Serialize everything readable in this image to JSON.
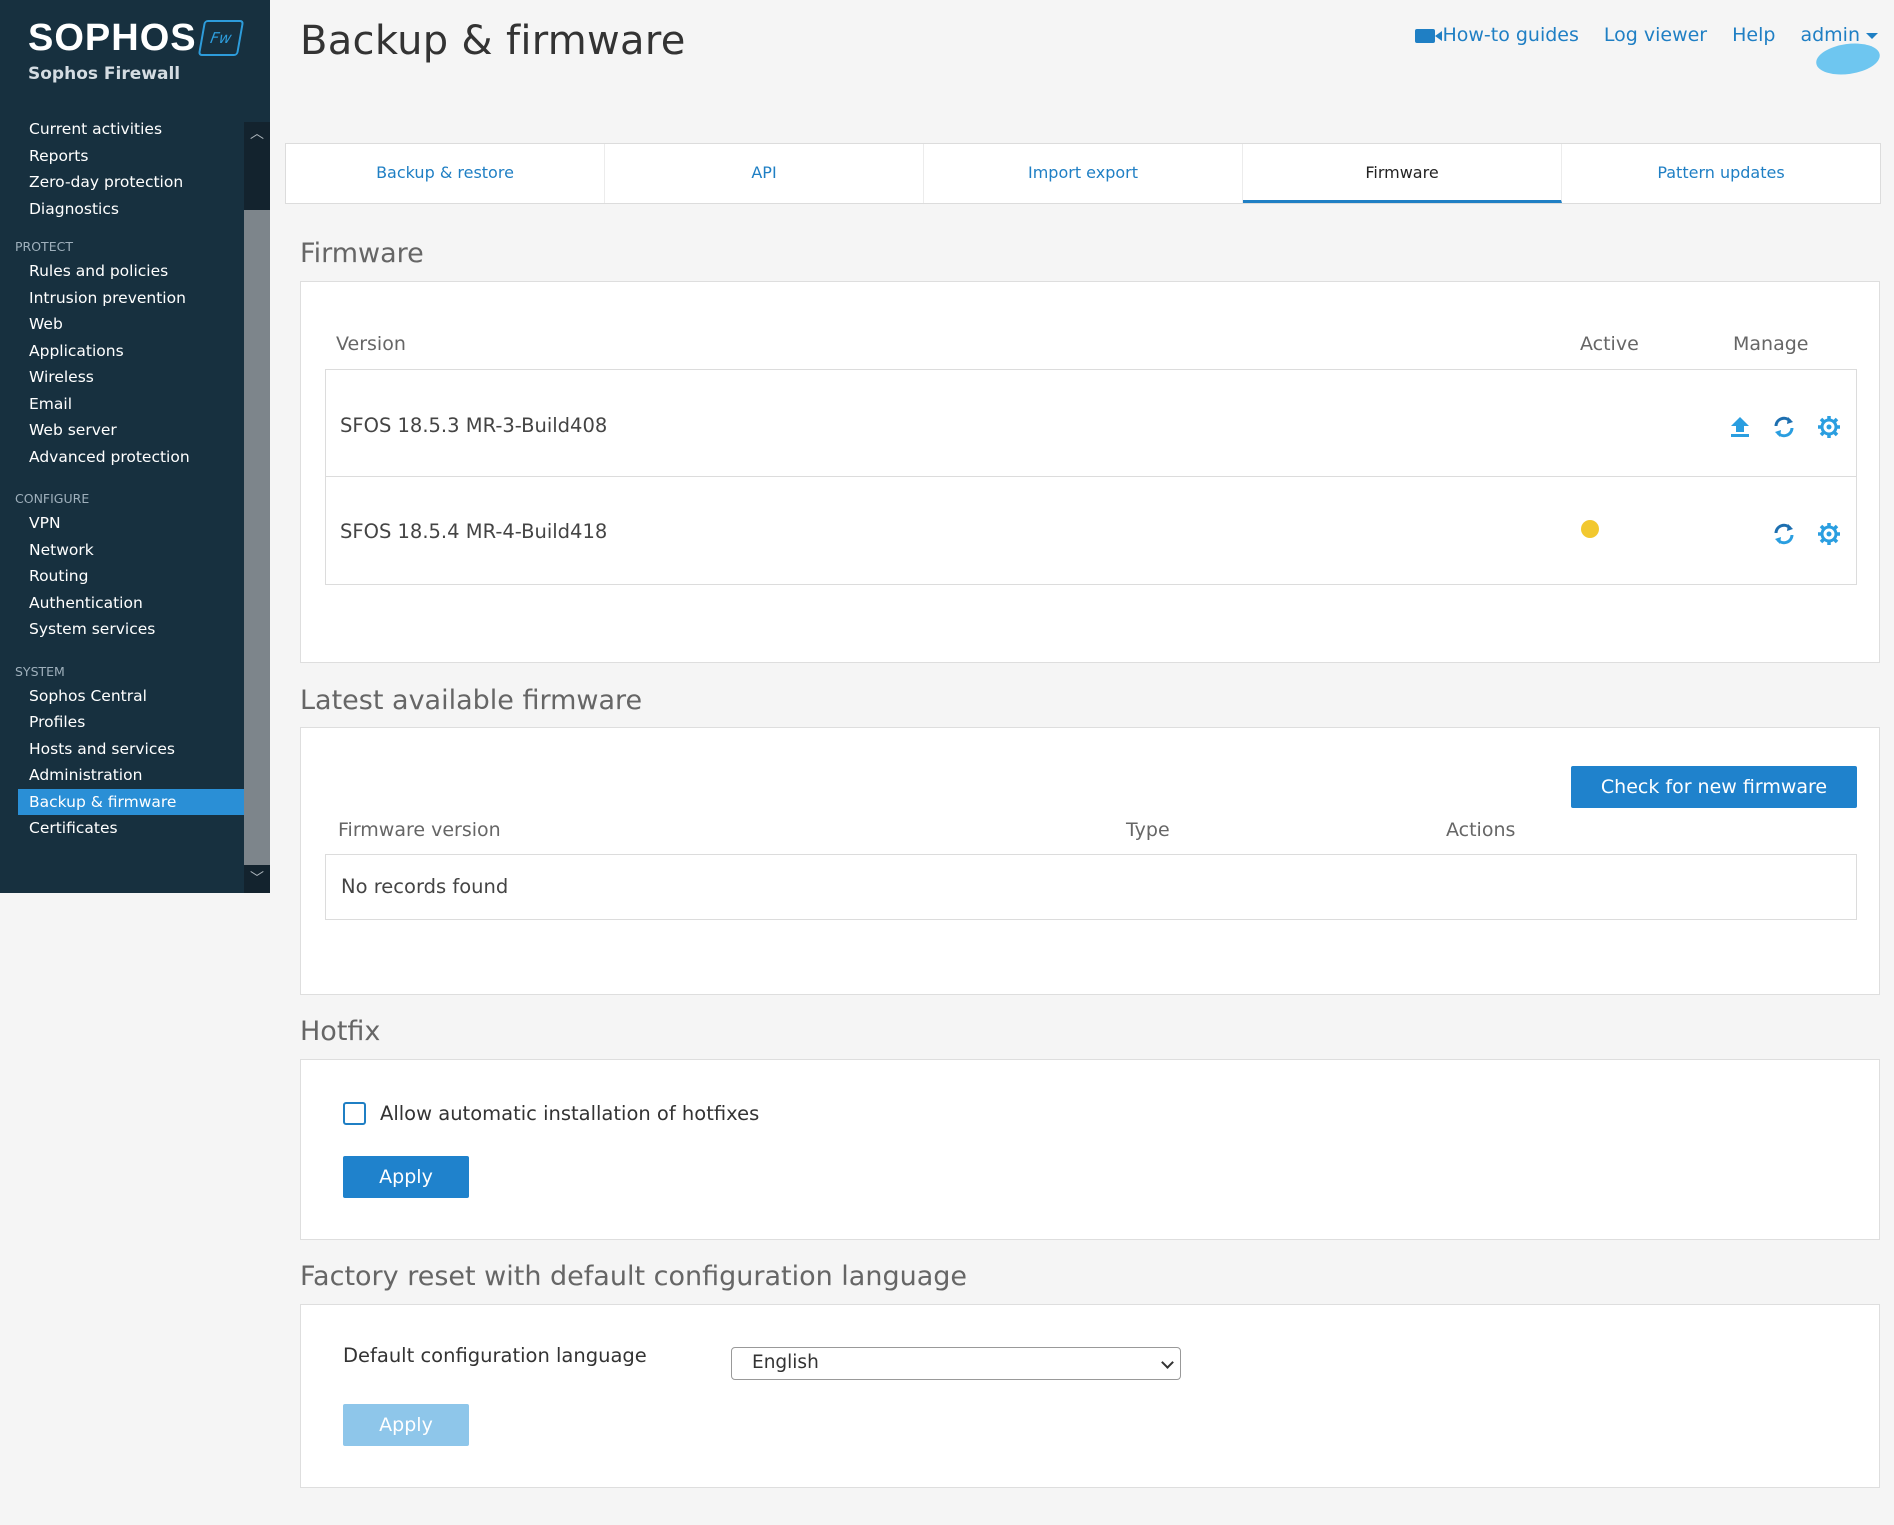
{
  "sidebar": {
    "brand": "SOPHOS",
    "badge": "Fw",
    "product": "Sophos Firewall",
    "top_items": [
      "Current activities",
      "Reports",
      "Zero-day protection",
      "Diagnostics"
    ],
    "protect_label": "PROTECT",
    "protect_items": [
      "Rules and policies",
      "Intrusion prevention",
      "Web",
      "Applications",
      "Wireless",
      "Email",
      "Web server",
      "Advanced protection"
    ],
    "configure_label": "CONFIGURE",
    "configure_items": [
      "VPN",
      "Network",
      "Routing",
      "Authentication",
      "System services"
    ],
    "system_label": "SYSTEM",
    "system_items": [
      "Sophos Central",
      "Profiles",
      "Hosts and services",
      "Administration",
      "Backup & firmware",
      "Certificates"
    ],
    "active_item": "Backup & firmware"
  },
  "header": {
    "title": "Backup & firmware",
    "links": {
      "guides": "How-to guides",
      "log_viewer": "Log viewer",
      "help": "Help",
      "user": "admin"
    }
  },
  "tabs": [
    "Backup & restore",
    "API",
    "Import export",
    "Firmware",
    "Pattern updates"
  ],
  "active_tab": "Firmware",
  "firmware": {
    "section_title": "Firmware",
    "columns": {
      "version": "Version",
      "active": "Active",
      "manage": "Manage"
    },
    "rows": [
      {
        "version": "SFOS 18.5.3 MR-3-Build408",
        "active": false,
        "icons": [
          "boot-upload-icon",
          "reboot-icon",
          "settings-gear-icon"
        ]
      },
      {
        "version": "SFOS 18.5.4 MR-4-Build418",
        "active": true,
        "icons": [
          "reboot-icon",
          "settings-gear-icon"
        ]
      }
    ]
  },
  "latest": {
    "section_title": "Latest available firmware",
    "check_button": "Check for new firmware",
    "columns": {
      "version": "Firmware version",
      "type": "Type",
      "actions": "Actions"
    },
    "empty": "No records found"
  },
  "hotfix": {
    "section_title": "Hotfix",
    "checkbox_label": "Allow automatic installation of hotfixes",
    "checked": false,
    "apply": "Apply"
  },
  "factory": {
    "section_title": "Factory reset with default configuration language",
    "label": "Default configuration language",
    "selected": "English",
    "apply": "Apply"
  },
  "colors": {
    "sidebar_bg": "#17303f",
    "accent": "#1f82cc",
    "active_nav": "#2a8fd6",
    "active_dot": "#f2c82f"
  }
}
